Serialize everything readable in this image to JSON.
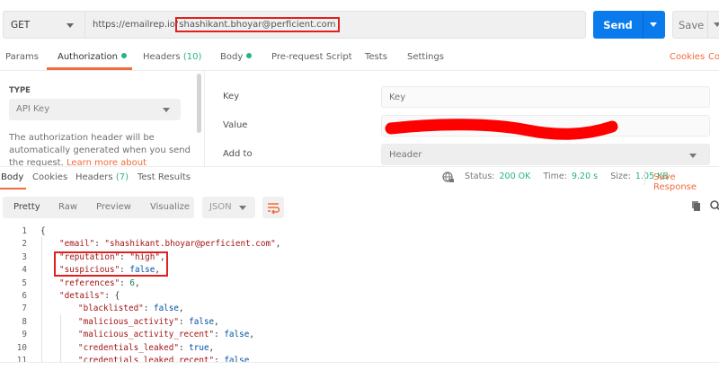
{
  "request": {
    "method": "GET",
    "url_prefix": "https://emailrep.io/",
    "url_highlight": "shashikant.bhoyar@perficient.com",
    "send_label": "Send",
    "save_label": "Save"
  },
  "request_tabs": [
    {
      "label": "Params"
    },
    {
      "label": "Authorization",
      "dot": true,
      "active": true
    },
    {
      "label": "Headers",
      "count": "(10)"
    },
    {
      "label": "Body",
      "dot": true
    },
    {
      "label": "Pre-request Script"
    },
    {
      "label": "Tests"
    },
    {
      "label": "Settings"
    }
  ],
  "links": {
    "cookies": "Cookies",
    "code": "Co"
  },
  "auth": {
    "type_label": "TYPE",
    "type_value": "API Key",
    "description": "The authorization header will be automatically generated when you send the request. ",
    "learn_more": "Learn more about",
    "key_label": "Key",
    "key_value": "Key",
    "value_label": "Value",
    "add_to_label": "Add to",
    "add_to_value": "Header"
  },
  "response_tabs": [
    {
      "label": "Body",
      "active": true
    },
    {
      "label": "Cookies"
    },
    {
      "label": "Headers",
      "count": "(7)"
    },
    {
      "label": "Test Results"
    }
  ],
  "status": {
    "status_label": "Status:",
    "status_value": "200 OK",
    "time_label": "Time:",
    "time_value": "9.20 s",
    "size_label": "Size:",
    "size_value": "1.05 KB",
    "save_response": "Save Response"
  },
  "format": {
    "pretty": "Pretty",
    "raw": "Raw",
    "preview": "Preview",
    "visualize": "Visualize",
    "json": "JSON"
  },
  "colors": {
    "accent": "#f26b3a",
    "send": "#097bed",
    "success": "#26b47f",
    "highlight": "#e02020"
  },
  "code_lines": [
    {
      "n": "1",
      "indent": 0,
      "parts": [
        [
          "p",
          "{"
        ]
      ]
    },
    {
      "n": "2",
      "indent": 1,
      "parts": [
        [
          "k",
          "\"email\""
        ],
        [
          "p",
          ": "
        ],
        [
          "s",
          "\"shashikant.bhoyar@perficient.com\""
        ],
        [
          "p",
          ","
        ]
      ]
    },
    {
      "n": "3",
      "indent": 1,
      "parts": [
        [
          "k",
          "\"reputation\""
        ],
        [
          "p",
          ": "
        ],
        [
          "s",
          "\"high\""
        ],
        [
          "p",
          ","
        ]
      ]
    },
    {
      "n": "4",
      "indent": 1,
      "parts": [
        [
          "k",
          "\"suspicious\""
        ],
        [
          "p",
          ": "
        ],
        [
          "b",
          "false"
        ],
        [
          "p",
          ","
        ]
      ]
    },
    {
      "n": "5",
      "indent": 1,
      "parts": [
        [
          "k",
          "\"references\""
        ],
        [
          "p",
          ": "
        ],
        [
          "n",
          "6"
        ],
        [
          "p",
          ","
        ]
      ]
    },
    {
      "n": "6",
      "indent": 1,
      "parts": [
        [
          "k",
          "\"details\""
        ],
        [
          "p",
          ": {"
        ]
      ]
    },
    {
      "n": "7",
      "indent": 2,
      "parts": [
        [
          "k",
          "\"blacklisted\""
        ],
        [
          "p",
          ": "
        ],
        [
          "b",
          "false"
        ],
        [
          "p",
          ","
        ]
      ]
    },
    {
      "n": "8",
      "indent": 2,
      "parts": [
        [
          "k",
          "\"malicious_activity\""
        ],
        [
          "p",
          ": "
        ],
        [
          "b",
          "false"
        ],
        [
          "p",
          ","
        ]
      ]
    },
    {
      "n": "9",
      "indent": 2,
      "parts": [
        [
          "k",
          "\"malicious_activity_recent\""
        ],
        [
          "p",
          ": "
        ],
        [
          "b",
          "false"
        ],
        [
          "p",
          ","
        ]
      ]
    },
    {
      "n": "10",
      "indent": 2,
      "parts": [
        [
          "k",
          "\"credentials_leaked\""
        ],
        [
          "p",
          ": "
        ],
        [
          "b",
          "true"
        ],
        [
          "p",
          ","
        ]
      ]
    },
    {
      "n": "11",
      "indent": 2,
      "parts": [
        [
          "k",
          "\"credentials_leaked_recent\""
        ],
        [
          "p",
          ": "
        ],
        [
          "b",
          "false"
        ]
      ]
    }
  ]
}
